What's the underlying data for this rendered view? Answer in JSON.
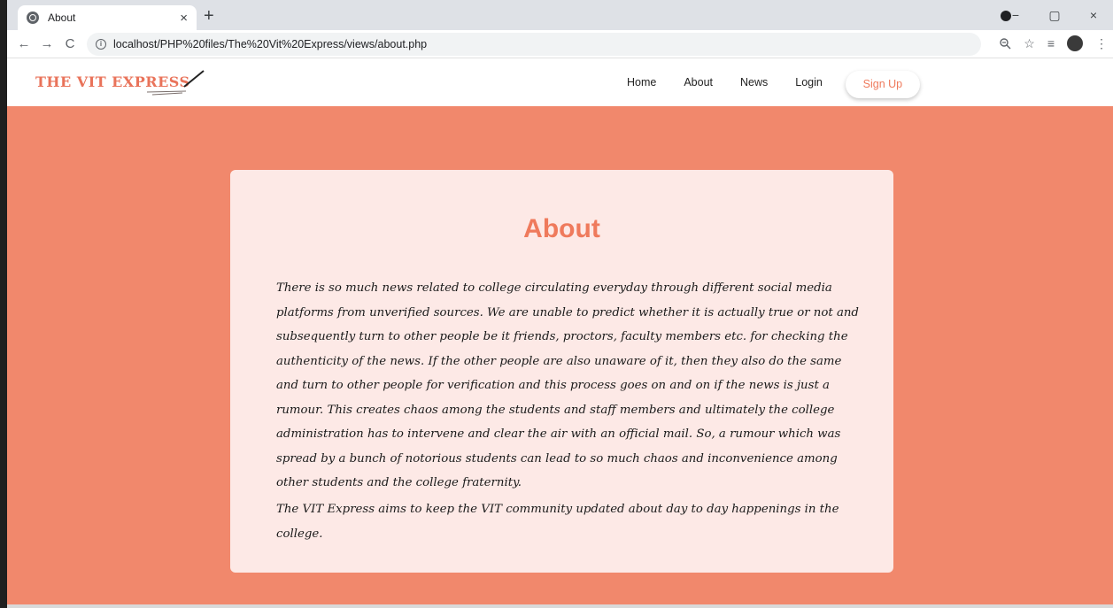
{
  "browser": {
    "tab_title": "About",
    "tab_close": "×",
    "new_tab": "+",
    "url": "localhost/PHP%20files/The%20Vit%20Express/views/about.php",
    "nav_back": "←",
    "nav_forward": "→",
    "nav_reload": "C",
    "window_min": "−",
    "window_max": "▢",
    "window_close": "×",
    "icons": [
      "zoom-icon",
      "star-icon",
      "reading-list-icon",
      "profile-avatar",
      "menu-icon"
    ]
  },
  "site": {
    "logo": "THE VIT EXPRESS",
    "nav": [
      "Home",
      "About",
      "News",
      "Login"
    ],
    "signup": "Sign Up",
    "accent_color": "#ef7a5c",
    "background_color": "#f1886c"
  },
  "about": {
    "title": "About",
    "paragraph1": "There is so much news related to college circulating everyday through different social media platforms from unverified sources. We are unable to predict whether it is actually true or not and subsequently turn to other people be it friends, proctors, faculty members etc. for checking the authenticity of the news. If the other people are also unaware of it, then they also do the same and turn to other people for verification and this process goes on and on if the news is just a rumour. This creates chaos among the students and staff members and ultimately the college administration has to intervene and clear the air with an official mail. So, a rumour which was spread by a bunch of notorious students can lead to so much chaos and inconvenience among other students and the college fraternity.",
    "paragraph2": "The VIT Express aims to keep the VIT community updated about day to day happenings in the college."
  }
}
